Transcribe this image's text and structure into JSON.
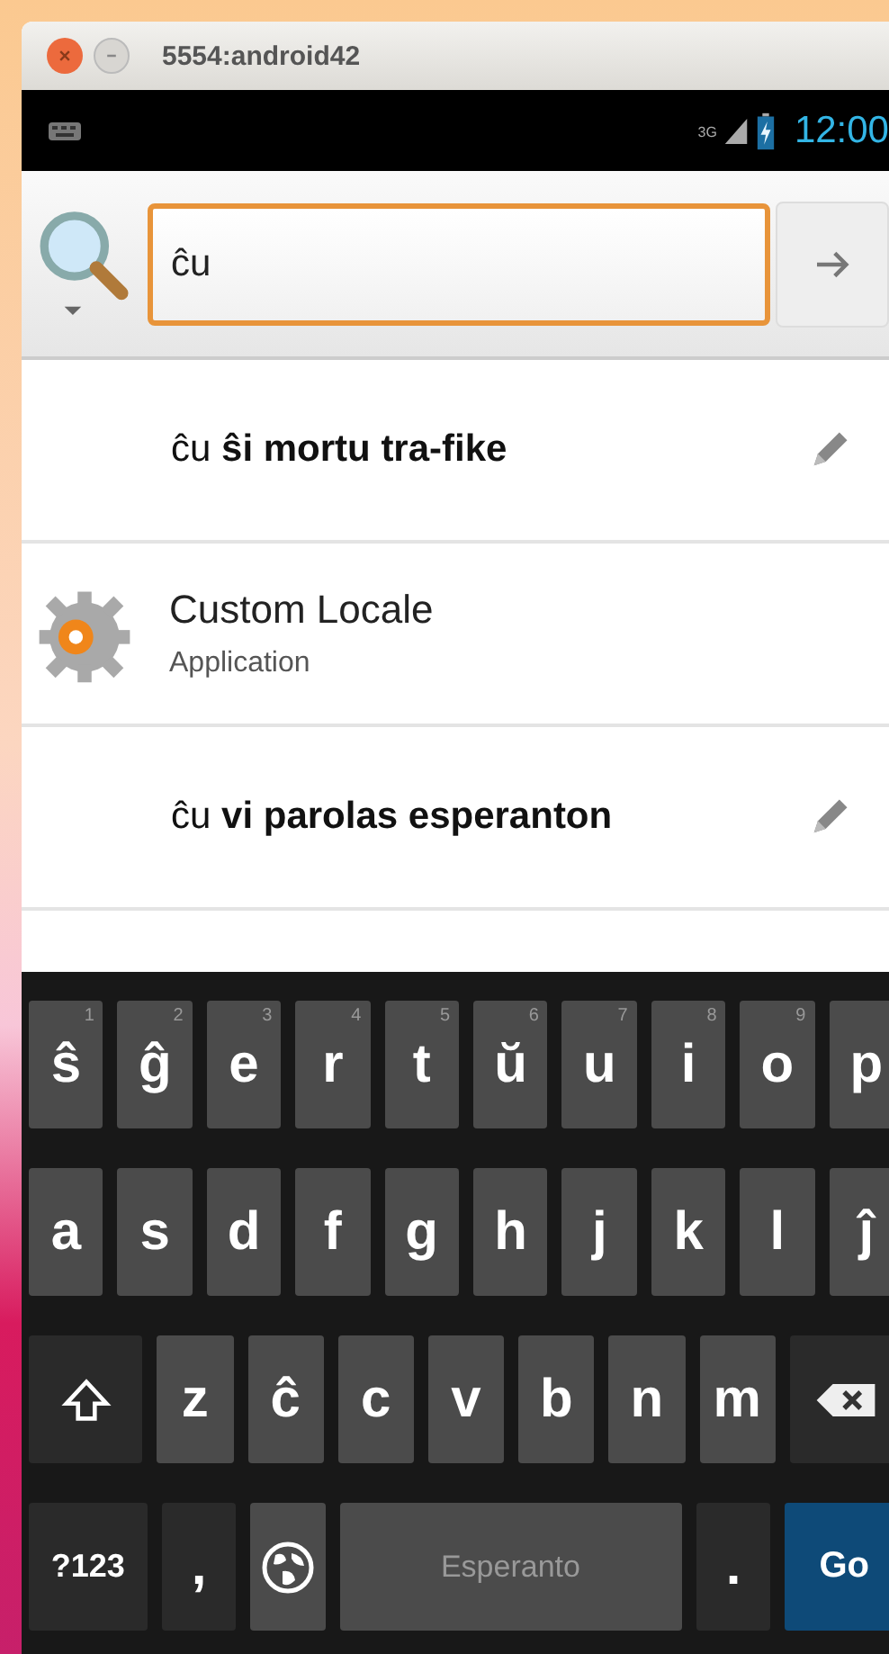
{
  "window": {
    "title": "5554:android42"
  },
  "status_bar": {
    "network": "3G",
    "time": "12:00"
  },
  "search": {
    "value": "ĉu"
  },
  "suggestions": [
    {
      "kind": "query",
      "text": "ĉu **ŝi mortu tra-fike**"
    },
    {
      "kind": "app",
      "title": "Custom Locale",
      "subtitle": "Application"
    },
    {
      "kind": "query",
      "text": "ĉu **vi parolas esperanton**"
    }
  ],
  "keyboard": {
    "rows": [
      {
        "keys": [
          {
            "kind": "letter",
            "label": "ŝ",
            "hint": "1"
          },
          {
            "kind": "letter",
            "label": "ĝ",
            "hint": "2"
          },
          {
            "kind": "letter",
            "label": "e",
            "hint": "3"
          },
          {
            "kind": "letter",
            "label": "r",
            "hint": "4"
          },
          {
            "kind": "letter",
            "label": "t",
            "hint": "5"
          },
          {
            "kind": "letter",
            "label": "ŭ",
            "hint": "6"
          },
          {
            "kind": "letter",
            "label": "u",
            "hint": "7"
          },
          {
            "kind": "letter",
            "label": "i",
            "hint": "8"
          },
          {
            "kind": "letter",
            "label": "o",
            "hint": "9"
          },
          {
            "kind": "letter",
            "label": "p"
          }
        ]
      },
      {
        "keys": [
          {
            "kind": "letter",
            "label": "a"
          },
          {
            "kind": "letter",
            "label": "s"
          },
          {
            "kind": "letter",
            "label": "d"
          },
          {
            "kind": "letter",
            "label": "f"
          },
          {
            "kind": "letter",
            "label": "g"
          },
          {
            "kind": "letter",
            "label": "h"
          },
          {
            "kind": "letter",
            "label": "j"
          },
          {
            "kind": "letter",
            "label": "k"
          },
          {
            "kind": "letter",
            "label": "l"
          },
          {
            "kind": "letter",
            "label": "ĵ"
          }
        ]
      },
      {
        "keys": [
          {
            "kind": "shift"
          },
          {
            "kind": "letter",
            "label": "z"
          },
          {
            "kind": "letter",
            "label": "ĉ"
          },
          {
            "kind": "letter",
            "label": "c"
          },
          {
            "kind": "letter",
            "label": "v"
          },
          {
            "kind": "letter",
            "label": "b"
          },
          {
            "kind": "letter",
            "label": "n"
          },
          {
            "kind": "letter",
            "label": "m"
          },
          {
            "kind": "delete"
          }
        ]
      },
      {
        "keys": [
          {
            "kind": "symbols",
            "label": "?123"
          },
          {
            "kind": "punct",
            "label": ","
          },
          {
            "kind": "globe"
          },
          {
            "kind": "space",
            "label": "Esperanto"
          },
          {
            "kind": "punct",
            "label": "."
          },
          {
            "kind": "go",
            "label": "Go"
          }
        ]
      }
    ]
  }
}
